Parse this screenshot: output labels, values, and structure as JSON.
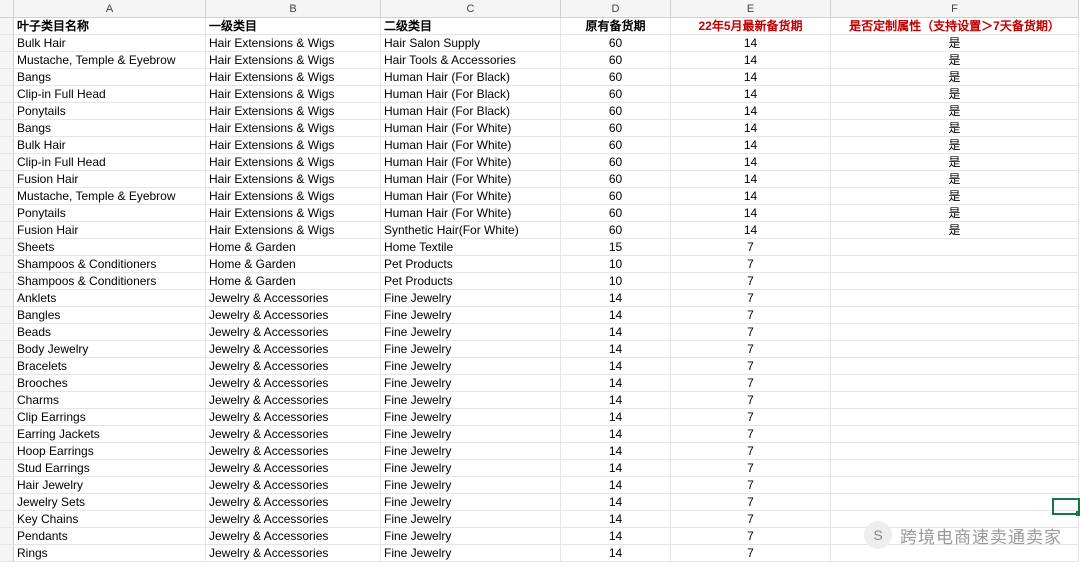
{
  "columns": {
    "labels": [
      "A",
      "B",
      "C",
      "D",
      "E",
      "F"
    ]
  },
  "headers": {
    "A": "叶子类目名称",
    "B": "一级类目",
    "C": "二级类目",
    "D": "原有备货期",
    "E": "22年5月最新备货期",
    "F": "是否定制属性（支持设置＞7天备货期）"
  },
  "rows": [
    {
      "A": "Bulk Hair",
      "B": "Hair Extensions & Wigs",
      "C": "Hair Salon Supply",
      "D": "60",
      "E": "14",
      "F": "是"
    },
    {
      "A": "Mustache, Temple & Eyebrow",
      "B": "Hair Extensions & Wigs",
      "C": "Hair Tools & Accessories",
      "D": "60",
      "E": "14",
      "F": "是"
    },
    {
      "A": "Bangs",
      "B": "Hair Extensions & Wigs",
      "C": "Human Hair (For Black)",
      "D": "60",
      "E": "14",
      "F": "是"
    },
    {
      "A": "Clip-in Full Head",
      "B": "Hair Extensions & Wigs",
      "C": "Human Hair (For Black)",
      "D": "60",
      "E": "14",
      "F": "是"
    },
    {
      "A": "Ponytails",
      "B": "Hair Extensions & Wigs",
      "C": "Human Hair (For Black)",
      "D": "60",
      "E": "14",
      "F": "是"
    },
    {
      "A": "Bangs",
      "B": "Hair Extensions & Wigs",
      "C": "Human Hair (For White)",
      "D": "60",
      "E": "14",
      "F": "是"
    },
    {
      "A": "Bulk Hair",
      "B": "Hair Extensions & Wigs",
      "C": "Human Hair (For White)",
      "D": "60",
      "E": "14",
      "F": "是"
    },
    {
      "A": "Clip-in Full Head",
      "B": "Hair Extensions & Wigs",
      "C": "Human Hair (For White)",
      "D": "60",
      "E": "14",
      "F": "是"
    },
    {
      "A": "Fusion Hair",
      "B": "Hair Extensions & Wigs",
      "C": "Human Hair (For White)",
      "D": "60",
      "E": "14",
      "F": "是"
    },
    {
      "A": "Mustache, Temple & Eyebrow",
      "B": "Hair Extensions & Wigs",
      "C": "Human Hair (For White)",
      "D": "60",
      "E": "14",
      "F": "是"
    },
    {
      "A": "Ponytails",
      "B": "Hair Extensions & Wigs",
      "C": "Human Hair (For White)",
      "D": "60",
      "E": "14",
      "F": "是"
    },
    {
      "A": "Fusion Hair",
      "B": "Hair Extensions & Wigs",
      "C": "Synthetic Hair(For White)",
      "D": "60",
      "E": "14",
      "F": "是"
    },
    {
      "A": "Sheets",
      "B": "Home & Garden",
      "C": "Home Textile",
      "D": "15",
      "E": "7",
      "F": ""
    },
    {
      "A": "Shampoos & Conditioners",
      "B": "Home & Garden",
      "C": "Pet Products",
      "D": "10",
      "E": "7",
      "F": ""
    },
    {
      "A": "Shampoos & Conditioners",
      "B": "Home & Garden",
      "C": "Pet Products",
      "D": "10",
      "E": "7",
      "F": ""
    },
    {
      "A": "Anklets",
      "B": "Jewelry & Accessories",
      "C": "Fine Jewelry",
      "D": "14",
      "E": "7",
      "F": ""
    },
    {
      "A": "Bangles",
      "B": "Jewelry & Accessories",
      "C": "Fine Jewelry",
      "D": "14",
      "E": "7",
      "F": ""
    },
    {
      "A": "Beads",
      "B": "Jewelry & Accessories",
      "C": "Fine Jewelry",
      "D": "14",
      "E": "7",
      "F": ""
    },
    {
      "A": "Body Jewelry",
      "B": "Jewelry & Accessories",
      "C": "Fine Jewelry",
      "D": "14",
      "E": "7",
      "F": ""
    },
    {
      "A": "Bracelets",
      "B": "Jewelry & Accessories",
      "C": "Fine Jewelry",
      "D": "14",
      "E": "7",
      "F": ""
    },
    {
      "A": "Brooches",
      "B": "Jewelry & Accessories",
      "C": "Fine Jewelry",
      "D": "14",
      "E": "7",
      "F": ""
    },
    {
      "A": "Charms",
      "B": "Jewelry & Accessories",
      "C": "Fine Jewelry",
      "D": "14",
      "E": "7",
      "F": ""
    },
    {
      "A": "Clip Earrings",
      "B": "Jewelry & Accessories",
      "C": "Fine Jewelry",
      "D": "14",
      "E": "7",
      "F": ""
    },
    {
      "A": "Earring Jackets",
      "B": "Jewelry & Accessories",
      "C": "Fine Jewelry",
      "D": "14",
      "E": "7",
      "F": ""
    },
    {
      "A": "Hoop Earrings",
      "B": "Jewelry & Accessories",
      "C": "Fine Jewelry",
      "D": "14",
      "E": "7",
      "F": ""
    },
    {
      "A": "Stud Earrings",
      "B": "Jewelry & Accessories",
      "C": "Fine Jewelry",
      "D": "14",
      "E": "7",
      "F": ""
    },
    {
      "A": "Hair Jewelry",
      "B": "Jewelry & Accessories",
      "C": "Fine Jewelry",
      "D": "14",
      "E": "7",
      "F": ""
    },
    {
      "A": "Jewelry Sets",
      "B": "Jewelry & Accessories",
      "C": "Fine Jewelry",
      "D": "14",
      "E": "7",
      "F": ""
    },
    {
      "A": "Key Chains",
      "B": "Jewelry & Accessories",
      "C": "Fine Jewelry",
      "D": "14",
      "E": "7",
      "F": ""
    },
    {
      "A": "Pendants",
      "B": "Jewelry & Accessories",
      "C": "Fine Jewelry",
      "D": "14",
      "E": "7",
      "F": ""
    },
    {
      "A": "Rings",
      "B": "Jewelry & Accessories",
      "C": "Fine Jewelry",
      "D": "14",
      "E": "7",
      "F": ""
    }
  ],
  "watermark": {
    "icon": "S",
    "text": "跨境电商速卖通卖家"
  }
}
